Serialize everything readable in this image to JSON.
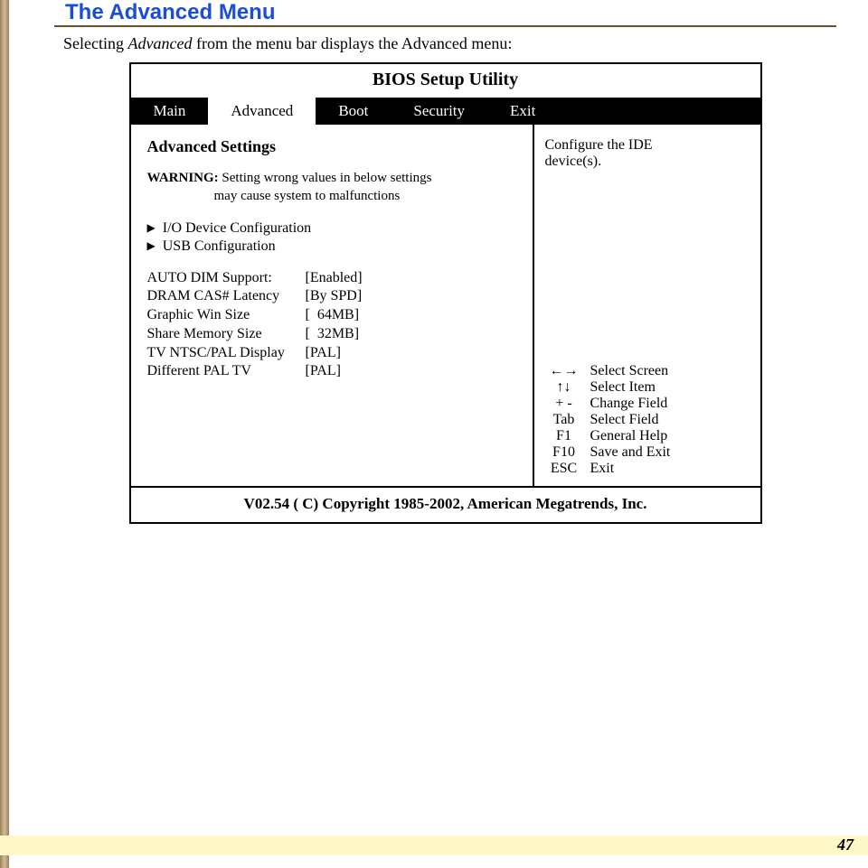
{
  "heading": "The Advanced Menu",
  "intro": {
    "pre": "Selecting ",
    "italic": "Advanced",
    "post": " from the menu bar displays the Advanced menu:"
  },
  "bios": {
    "title": "BIOS Setup Utility",
    "tabs": [
      "Main",
      "Advanced",
      "Boot",
      "Security",
      "Exit"
    ],
    "active_tab_index": 1,
    "settings_title": "Advanced Settings",
    "warning_label": "WARNING:",
    "warning_line1": "Setting wrong values in below settings",
    "warning_line2": "may cause system to malfunctions",
    "subitems": [
      "I/O Device Configuration",
      "USB Configuration"
    ],
    "options": [
      {
        "label": "AUTO DIM Support:",
        "value": "[Enabled]"
      },
      {
        "label": "DRAM CAS# Latency",
        "value": "[By SPD]"
      },
      {
        "label": "Graphic Win Size",
        "value": "[  64MB]"
      },
      {
        "label": "Share Memory Size",
        "value": "[  32MB]"
      },
      {
        "label": "TV NTSC/PAL Display",
        "value": "[PAL]"
      },
      {
        "label": "Different PAL TV",
        "value": "[PAL]"
      }
    ],
    "help_text_line1": "Configure the IDE",
    "help_text_line2": "device(s).",
    "keys": [
      {
        "sym": "←→",
        "label": "Select Screen"
      },
      {
        "sym": "↑↓",
        "label": "Select Item"
      },
      {
        "sym": "+ -",
        "label": "Change Field"
      },
      {
        "sym": "Tab",
        "label": "Select Field"
      },
      {
        "sym": "F1",
        "label": "General Help"
      },
      {
        "sym": "F10",
        "label": "Save and Exit"
      },
      {
        "sym": "ESC",
        "label": "Exit"
      }
    ],
    "footer": "V02.54  ( C) Copyright 1985-2002, American Megatrends, Inc."
  },
  "page_number": "47"
}
